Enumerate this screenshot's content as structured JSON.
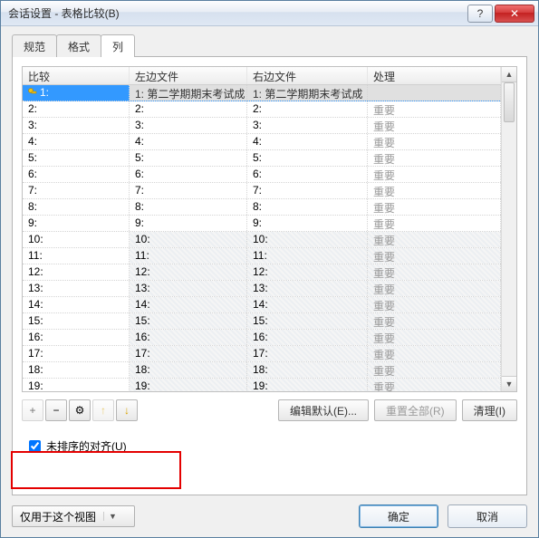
{
  "window": {
    "title": "会话设置 - 表格比较(B)"
  },
  "tabs": [
    {
      "label": "规范",
      "active": false
    },
    {
      "label": "格式",
      "active": false
    },
    {
      "label": "列",
      "active": true
    }
  ],
  "grid": {
    "headers": {
      "compare": "比较",
      "left": "左边文件",
      "right": "右边文件",
      "proc": "处理"
    },
    "rows": [
      {
        "compare": "1:",
        "left": "1:  第二学期期末考试成",
        "right": "1:  第二学期期末考试成",
        "proc": "",
        "key": true,
        "selected": true,
        "contentbg": true
      },
      {
        "compare": "2:",
        "left": "2:",
        "right": "2:",
        "proc": "重要"
      },
      {
        "compare": "3:",
        "left": "3:",
        "right": "3:",
        "proc": "重要"
      },
      {
        "compare": "4:",
        "left": "4:",
        "right": "4:",
        "proc": "重要"
      },
      {
        "compare": "5:",
        "left": "5:",
        "right": "5:",
        "proc": "重要"
      },
      {
        "compare": "6:",
        "left": "6:",
        "right": "6:",
        "proc": "重要"
      },
      {
        "compare": "7:",
        "left": "7:",
        "right": "7:",
        "proc": "重要"
      },
      {
        "compare": "8:",
        "left": "8:",
        "right": "8:",
        "proc": "重要"
      },
      {
        "compare": "9:",
        "left": "9:",
        "right": "9:",
        "proc": "重要"
      },
      {
        "compare": "10:",
        "left": "10:",
        "right": "10:",
        "proc": "重要",
        "hatched": true
      },
      {
        "compare": "11:",
        "left": "11:",
        "right": "11:",
        "proc": "重要",
        "hatched": true
      },
      {
        "compare": "12:",
        "left": "12:",
        "right": "12:",
        "proc": "重要",
        "hatched": true
      },
      {
        "compare": "13:",
        "left": "13:",
        "right": "13:",
        "proc": "重要",
        "hatched": true
      },
      {
        "compare": "14:",
        "left": "14:",
        "right": "14:",
        "proc": "重要",
        "hatched": true
      },
      {
        "compare": "15:",
        "left": "15:",
        "right": "15:",
        "proc": "重要",
        "hatched": true
      },
      {
        "compare": "16:",
        "left": "16:",
        "right": "16:",
        "proc": "重要",
        "hatched": true
      },
      {
        "compare": "17:",
        "left": "17:",
        "right": "17:",
        "proc": "重要",
        "hatched": true
      },
      {
        "compare": "18:",
        "left": "18:",
        "right": "18:",
        "proc": "重要",
        "hatched": true
      },
      {
        "compare": "19:",
        "left": "19:",
        "right": "19:",
        "proc": "重要",
        "hatched": true
      }
    ]
  },
  "toolbar": {
    "add": "+",
    "remove": "−",
    "settings": "⚙",
    "up": "↑",
    "down": "↓",
    "edit_default": "编辑默认(E)...",
    "reset_all": "重置全部(R)",
    "clear": "清理(I)"
  },
  "checkbox": {
    "label": "未排序的对齐(U)",
    "checked": true
  },
  "footer": {
    "scope": "仅用于这个视图",
    "ok": "确定",
    "cancel": "取消"
  },
  "winbtns": {
    "help": "?",
    "close": "✕"
  }
}
